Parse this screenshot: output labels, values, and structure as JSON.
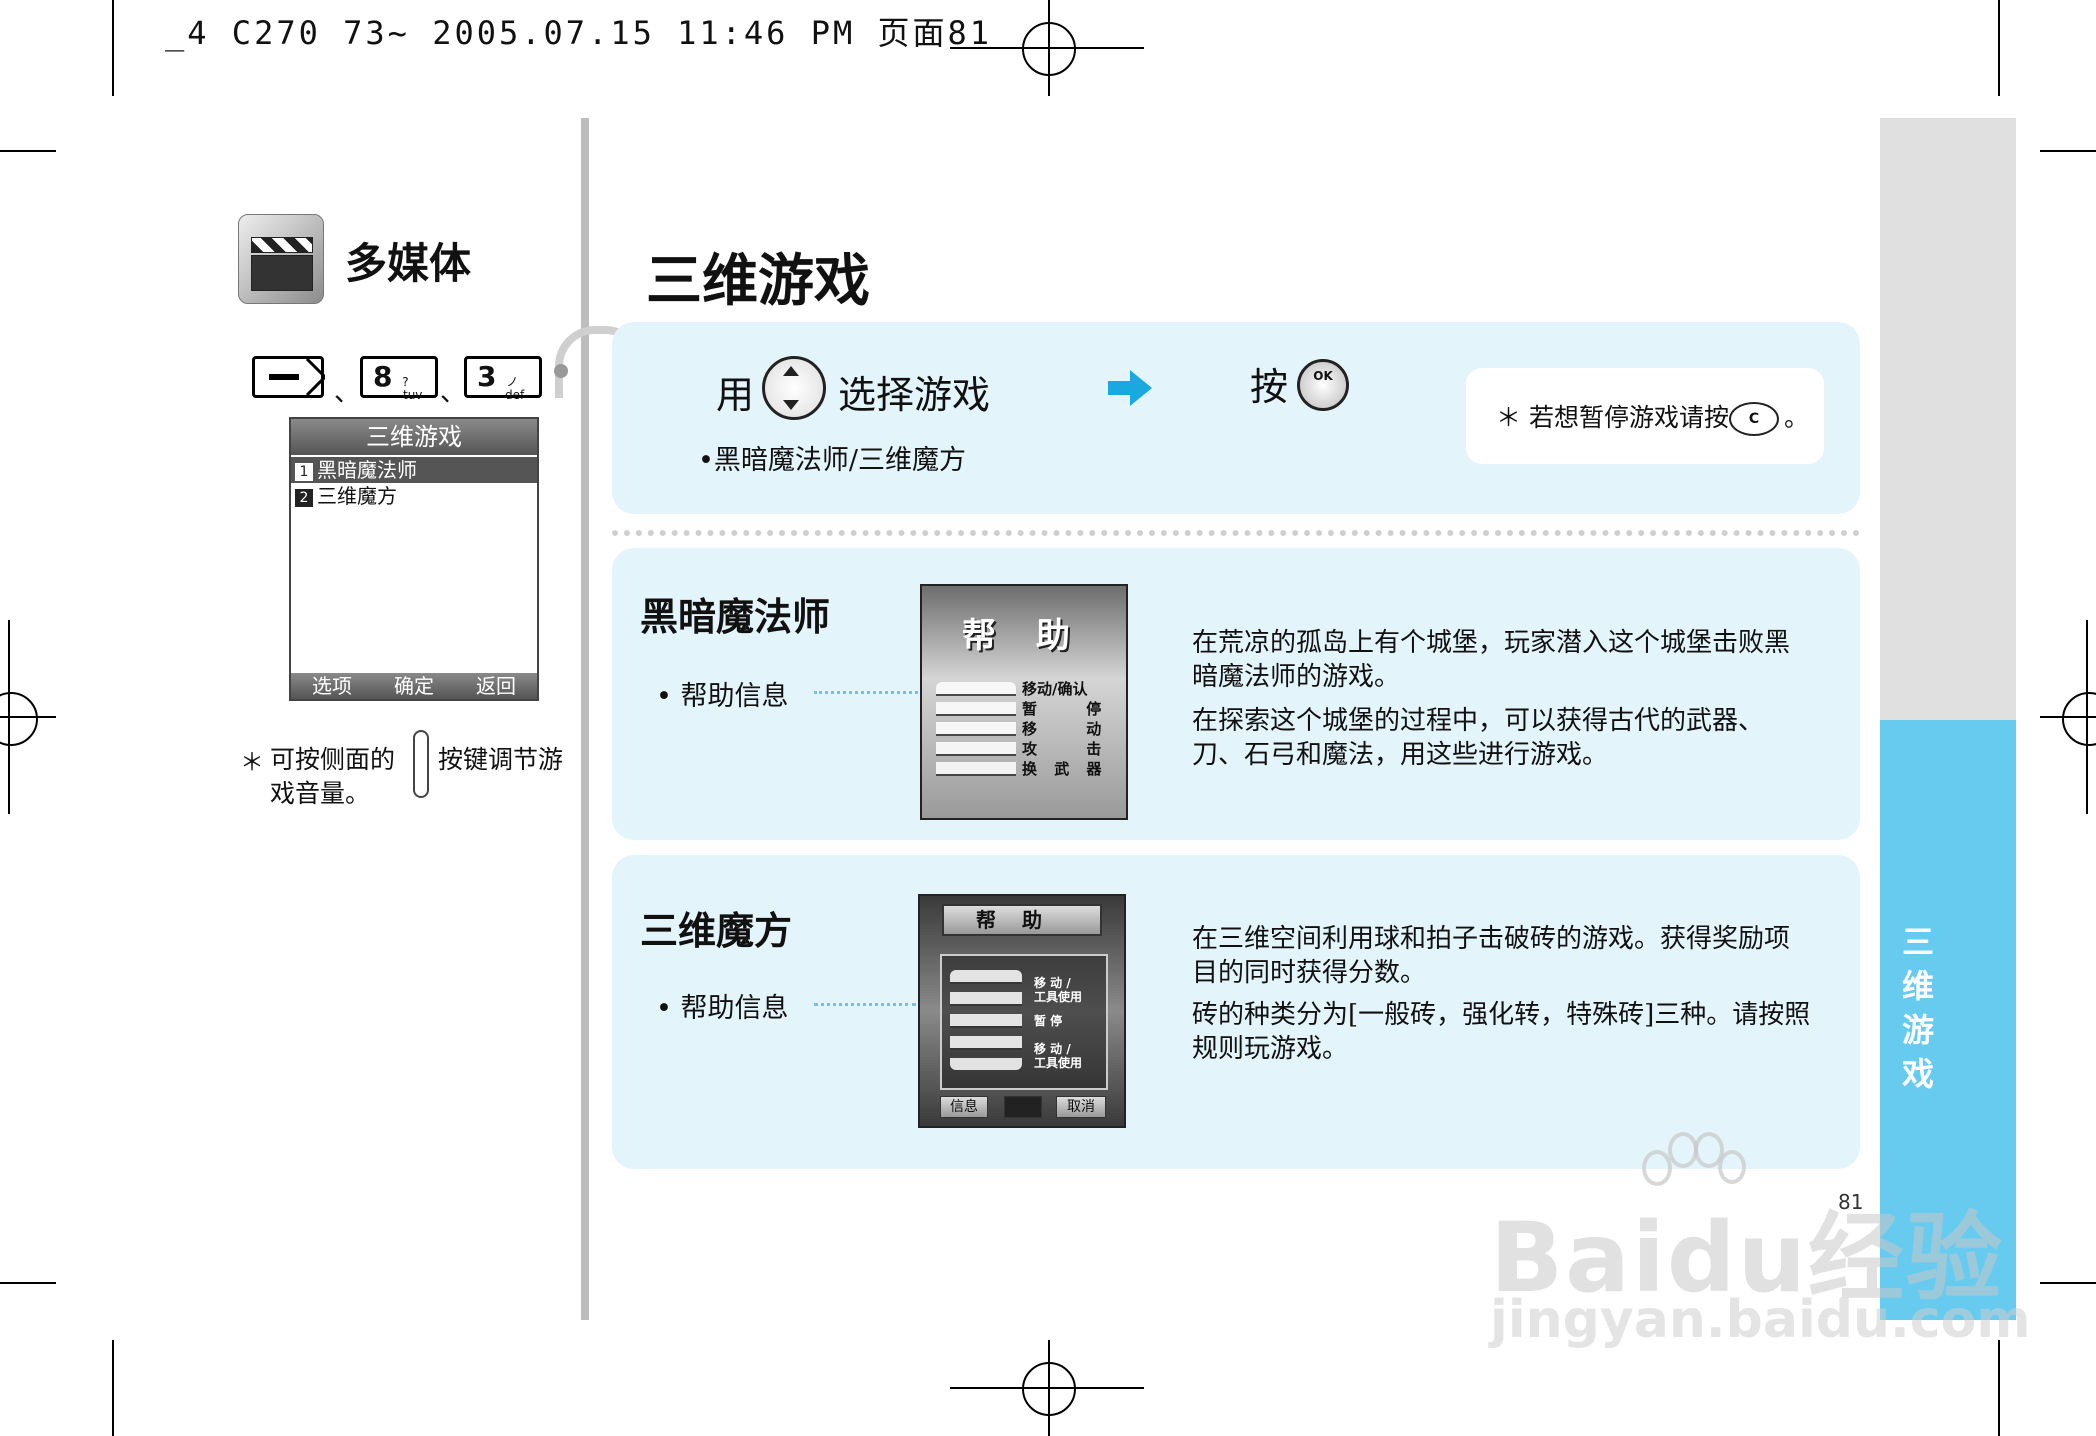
{
  "header": {
    "print_info": "_4 C270 73~ 2005.07.15 11:46 PM 页面81"
  },
  "sidebar": {
    "section_title": "多媒体",
    "key_sequence": [
      {
        "key": "8",
        "sub": "tuv",
        "symbol": "?"
      },
      {
        "key": "3",
        "sub": "def",
        "symbol": "ノ"
      }
    ],
    "separator": "、",
    "phone_menu": {
      "title": "三维游戏",
      "items": [
        {
          "num": "1",
          "label": "黑暗魔法师"
        },
        {
          "num": "2",
          "label": "三维魔方"
        }
      ],
      "softkeys": [
        "选项",
        "确定",
        "返回"
      ]
    },
    "note_prefix": "＊",
    "note_part1": "可按侧面的",
    "note_part2": "按键调节游",
    "note_line2": "戏音量。"
  },
  "main": {
    "title": "三维游戏",
    "step": {
      "use_label": "用",
      "select_label": "选择游戏",
      "press_label": "按",
      "ok_key": "OK",
      "game_list": "•黑暗魔法师/三维魔方",
      "pause_note": "＊ 若想暂停游戏请按",
      "pause_key": "C",
      "pause_end": "。"
    },
    "games": [
      {
        "title": "黑暗魔法师",
        "help_label": "• 帮助信息",
        "screenshot": {
          "title": "帮 助",
          "rows": [
            "移动/确认",
            "暂 停",
            "移 动",
            "攻 击",
            "换 武 器"
          ]
        },
        "desc_p1": "在荒凉的孤岛上有个城堡，玩家潜入这个城堡击败黑暗魔法师的游戏。",
        "desc_p2": "在探索这个城堡的过程中，可以获得古代的武器、刀、石弓和魔法，用这些进行游戏。"
      },
      {
        "title": "三维魔方",
        "help_label": "• 帮助信息",
        "screenshot": {
          "title": "帮助",
          "rows": [
            "移 动 /",
            "工具使用",
            "暂 停",
            "移 动 /",
            "工具使用"
          ],
          "buttons": [
            "信息",
            "取消"
          ]
        },
        "desc_p1": "在三维空间利用球和拍子击破砖的游戏。获得奖励项目的同时获得分数。",
        "desc_p2": "砖的种类分为[一般砖，强化转，特殊砖]三种。请按照规则玩游戏。"
      }
    ]
  },
  "side_tab": {
    "label": "三维游戏"
  },
  "page_number": "81",
  "watermark": {
    "brand": "Baidu经验",
    "url": "jingyan.baidu.com"
  },
  "colors": {
    "panel": "#e3f4fb",
    "accent": "#1aa8e0",
    "tab_blue": "#67cbf0",
    "tab_grey": "#e0e0e0"
  }
}
